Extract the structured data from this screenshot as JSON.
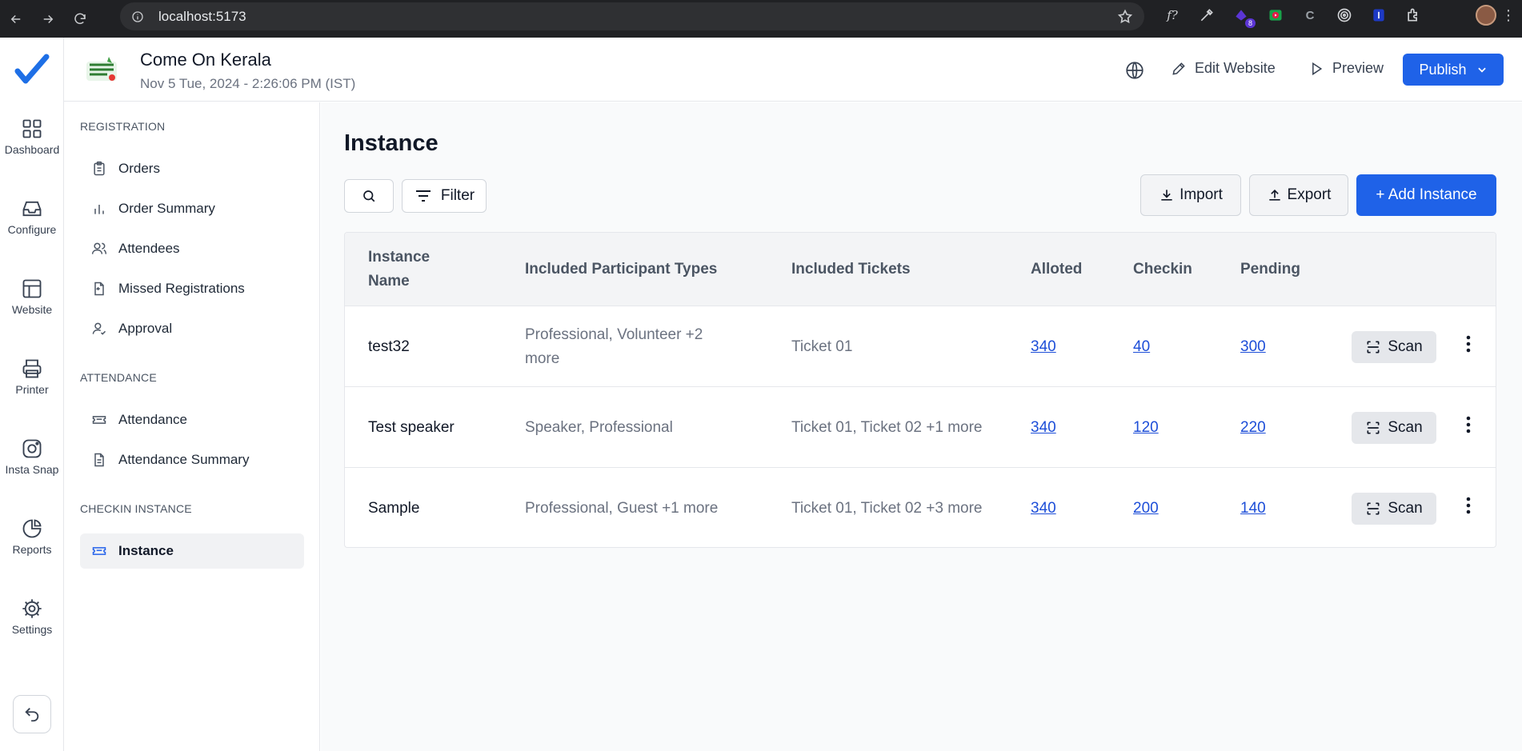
{
  "browser": {
    "url": "localhost:5173",
    "extension_badge": "8"
  },
  "rail": {
    "items": [
      {
        "label": "Dashboard",
        "icon": "grid-icon"
      },
      {
        "label": "Configure",
        "icon": "inbox-icon"
      },
      {
        "label": "Website",
        "icon": "layout-icon"
      },
      {
        "label": "Printer",
        "icon": "printer-icon"
      },
      {
        "label": "Insta Snap",
        "icon": "instagram-icon"
      },
      {
        "label": "Reports",
        "icon": "pie-chart-icon"
      },
      {
        "label": "Settings",
        "icon": "gear-icon"
      }
    ]
  },
  "header": {
    "event_title": "Come On Kerala",
    "event_datetime": "Nov 5 Tue, 2024 - 2:26:06 PM (IST)",
    "edit_website_label": "Edit Website",
    "preview_label": "Preview",
    "publish_label": "Publish"
  },
  "sidebar": {
    "sections": [
      {
        "title": "REGISTRATION",
        "items": [
          {
            "label": "Orders",
            "icon": "clipboard-icon"
          },
          {
            "label": "Order Summary",
            "icon": "bar-chart-icon"
          },
          {
            "label": "Attendees",
            "icon": "users-icon"
          },
          {
            "label": "Missed Registrations",
            "icon": "file-return-icon"
          },
          {
            "label": "Approval",
            "icon": "user-check-icon"
          }
        ]
      },
      {
        "title": "ATTENDANCE",
        "items": [
          {
            "label": "Attendance",
            "icon": "ticket-icon"
          },
          {
            "label": "Attendance Summary",
            "icon": "file-text-icon"
          }
        ]
      },
      {
        "title": "CHECKIN INSTANCE",
        "items": [
          {
            "label": "Instance",
            "icon": "ticket-icon",
            "active": true
          }
        ]
      }
    ]
  },
  "main": {
    "title": "Instance",
    "filter_label": "Filter",
    "import_label": "Import",
    "export_label": "Export",
    "add_label": "+ Add Instance",
    "columns": [
      "Instance Name",
      "Included Participant Types",
      "Included Tickets",
      "Alloted",
      "Checkin",
      "Pending"
    ],
    "rows": [
      {
        "name": "test32",
        "participant_types": "Professional, Volunteer +2 more",
        "tickets": "Ticket 01",
        "alloted": "340",
        "checkin": "40",
        "pending": "300",
        "scan_label": "Scan"
      },
      {
        "name": "Test speaker",
        "participant_types": "Speaker, Professional",
        "tickets": "Ticket 01, Ticket 02 +1 more",
        "alloted": "340",
        "checkin": "120",
        "pending": "220",
        "scan_label": "Scan"
      },
      {
        "name": "Sample",
        "participant_types": "Professional, Guest +1 more",
        "tickets": "Ticket 01, Ticket 02 +3 more",
        "alloted": "340",
        "checkin": "200",
        "pending": "140",
        "scan_label": "Scan"
      }
    ]
  },
  "colors": {
    "primary": "#1f62e8",
    "link": "#1d4ed8",
    "chrome_bg": "#202124"
  }
}
